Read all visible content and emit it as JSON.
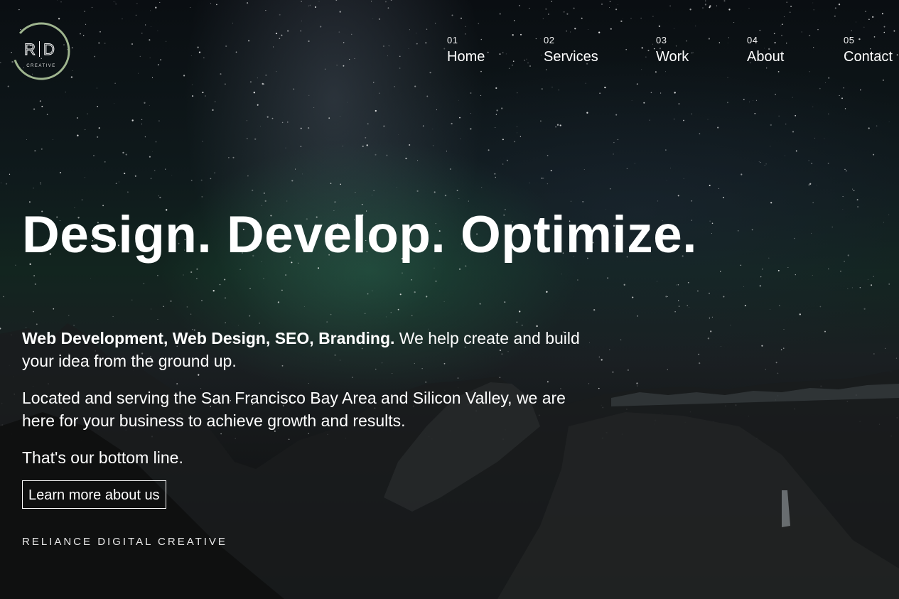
{
  "logo": {
    "initial_left": "R",
    "initial_right": "D",
    "subtext": "CREATIVE"
  },
  "nav": [
    {
      "num": "01",
      "label": "Home"
    },
    {
      "num": "02",
      "label": "Services"
    },
    {
      "num": "03",
      "label": "Work"
    },
    {
      "num": "04",
      "label": "About"
    },
    {
      "num": "05",
      "label": "Contact"
    }
  ],
  "hero": {
    "headline": "Design. Develop. Optimize.",
    "intro_bold": "Web Development, Web Design, SEO, Branding.",
    "intro_rest": " We help create and build your idea from the ground up.",
    "location": "Located and serving the San Francisco Bay Area and Silicon Valley, we are here for your business to achieve growth and results.",
    "bottom_line": "That's our bottom line.",
    "cta_label": "Learn more about us",
    "brand_name": "RELIANCE DIGITAL CREATIVE"
  },
  "colors": {
    "text": "#ffffff",
    "logo_ring": "#9fb58f"
  },
  "icons": [
    "logo-mark"
  ]
}
